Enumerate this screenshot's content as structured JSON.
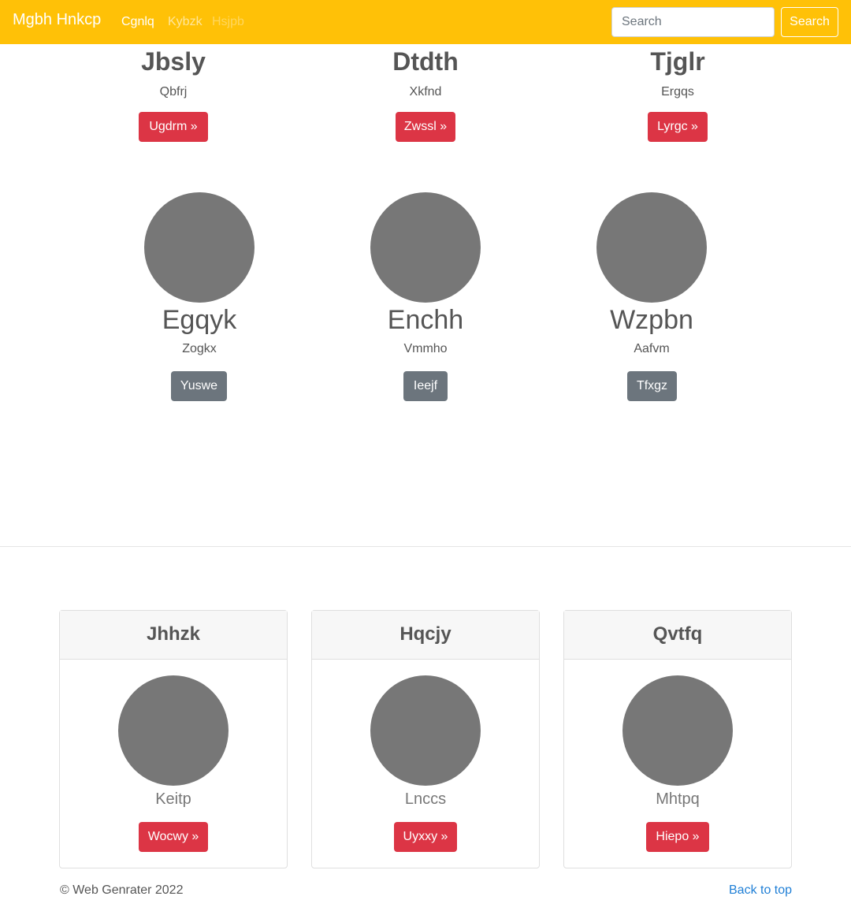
{
  "navbar": {
    "brand": "Mgbh Hnkcp",
    "links": [
      "Cgnlq",
      "Kybzk",
      "Hsjpb"
    ],
    "search_placeholder": "Search",
    "search_button": "Search",
    "color": "#ffc107"
  },
  "featured": [
    {
      "title": "Jbsly",
      "subtitle": "Qbfrj",
      "button": "Ugdrm »"
    },
    {
      "title": "Dtdth",
      "subtitle": "Xkfnd",
      "button": "Zwssl »"
    },
    {
      "title": "Tjglr",
      "subtitle": "Ergqs",
      "button": "Lyrgc »"
    }
  ],
  "people": [
    {
      "name": "Egqyk",
      "subtitle": "Zogkx",
      "button": "Yuswe"
    },
    {
      "name": "Enchh",
      "subtitle": "Vmmho",
      "button": "Ieejf"
    },
    {
      "name": "Wzpbn",
      "subtitle": "Aafvm",
      "button": "Tfxgz"
    }
  ],
  "cards": [
    {
      "header": "Jhhzk",
      "name": "Keitp",
      "button": "Wocwy »"
    },
    {
      "header": "Hqcjy",
      "name": "Lnccs",
      "button": "Uyxxy »"
    },
    {
      "header": "Qvtfq",
      "name": "Mhtpq",
      "button": "Hiepo »"
    }
  ],
  "footer": {
    "copyright": "© Web Genrater 2022",
    "back_to_top": "Back to top"
  },
  "colors": {
    "danger": "#dc3545",
    "secondary": "#6c757d",
    "link": "#1f7fd6",
    "avatar": "#777777"
  }
}
